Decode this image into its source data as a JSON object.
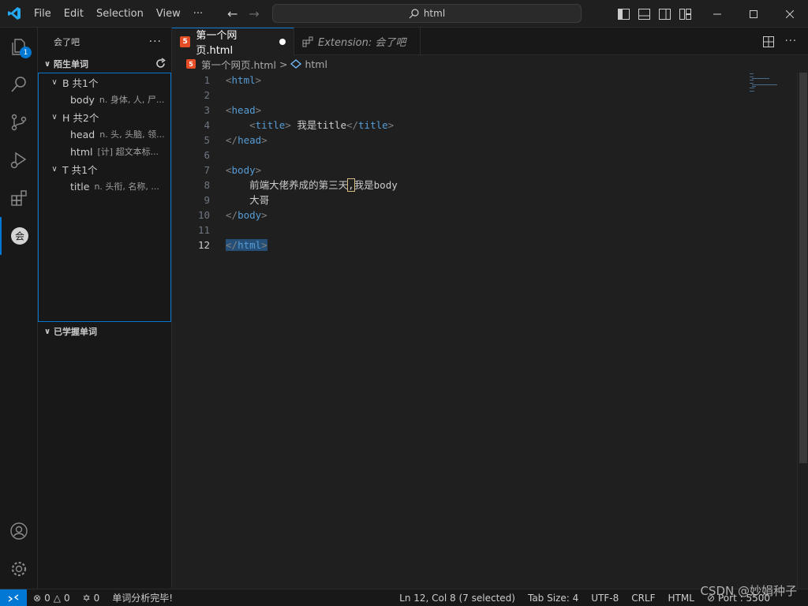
{
  "titlebar": {
    "menu": [
      "File",
      "Edit",
      "Selection",
      "View",
      "···"
    ],
    "search": "html",
    "icons": [
      "vscode-logo-icon",
      "arrow-left-icon",
      "arrow-right-icon",
      "search-icon",
      "toggle-primary-sidebar-icon",
      "toggle-panel-icon",
      "toggle-secondary-sidebar-icon",
      "customize-layout-icon",
      "minimize-icon",
      "maximize-icon",
      "close-icon"
    ]
  },
  "activity": {
    "badge": "1",
    "icons": [
      "explorer-icon",
      "search-icon",
      "source-control-icon",
      "run-debug-icon",
      "extensions-icon",
      "huiliaoba-extension-icon",
      "account-icon",
      "settings-gear-icon"
    ]
  },
  "sidebar": {
    "title": "会了吧",
    "more": "···",
    "section_unknown": "陌生单词",
    "section_learned": "已学握单词",
    "groups": [
      {
        "label": "B  共1个",
        "words": [
          {
            "word": "body",
            "def": "n. 身体, 人, 尸..."
          }
        ]
      },
      {
        "label": "H  共2个",
        "words": [
          {
            "word": "head",
            "def": "n. 头, 头脑, 领..."
          },
          {
            "word": "html",
            "def": "[计] 超文本标..."
          }
        ]
      },
      {
        "label": "T  共1个",
        "words": [
          {
            "word": "title",
            "def": "n. 头衔, 名称, ..."
          }
        ]
      }
    ]
  },
  "tabs": [
    {
      "label": "第一个网页.html",
      "active": true
    },
    {
      "label": "Extension: 会了吧",
      "active": false
    }
  ],
  "breadcrumb": {
    "file": "第一个网页.html",
    "separator": ">",
    "symbol": "html"
  },
  "editor": {
    "line_numbers": [
      "1",
      "2",
      "3",
      "4",
      "5",
      "6",
      "7",
      "8",
      "9",
      "10",
      "11",
      "12"
    ],
    "current_line": "12",
    "lines": {
      "l4_text": " 我是title",
      "l8_text_a": "前端大佬养成的第三天",
      "l8_comma": ",",
      "l8_text_b": "我是body",
      "l9_text": "大哥"
    }
  },
  "statusbar": {
    "errors": "0",
    "warnings": "0",
    "ports": "0",
    "message": "单词分析完毕!",
    "position": "Ln 12, Col 8 (7 selected)",
    "tab_size": "Tab Size: 4",
    "encoding": "UTF-8",
    "eol": "CRLF",
    "language": "HTML",
    "port": "Port : 5500",
    "watermark": "CSDN @妙娟种子"
  },
  "colors": {
    "accent": "#0078d4",
    "tag": "#569cd6",
    "html_icon": "#e44d26"
  }
}
